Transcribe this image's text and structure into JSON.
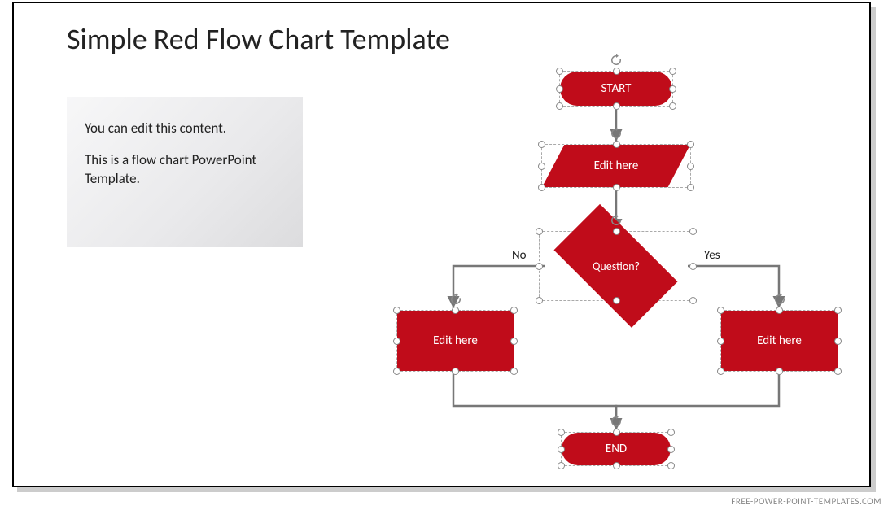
{
  "title": "Simple Red Flow Chart Template",
  "textbox": {
    "line1": "You can edit this content.",
    "line2": "This is a flow chart PowerPoint Template."
  },
  "flow": {
    "start": {
      "label": "START"
    },
    "input": {
      "label": "Edit here"
    },
    "decision": {
      "label": "Question?",
      "no_label": "No",
      "yes_label": "Yes"
    },
    "left_proc": {
      "label": "Edit here"
    },
    "right_proc": {
      "label": "Edit here"
    },
    "end": {
      "label": "END"
    }
  },
  "watermark": "FREE-POWER-POINT-TEMPLATES.COM",
  "colors": {
    "accent": "#c00c1a"
  }
}
